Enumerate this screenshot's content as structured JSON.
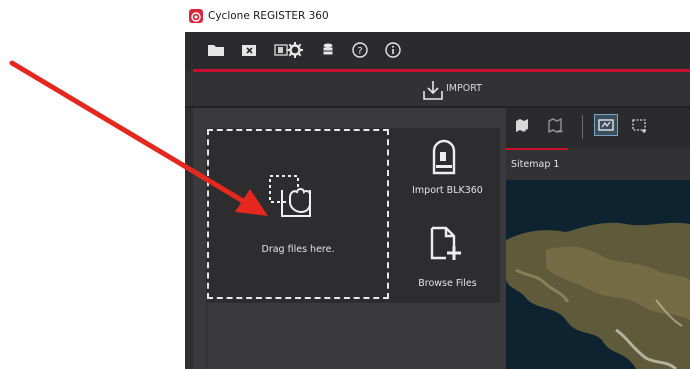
{
  "window": {
    "title": "Cyclone REGISTER 360",
    "app_icon": "cyclone-logo-icon",
    "accent": "#c8102e"
  },
  "toolbar": {
    "icons": [
      "open-folder-icon",
      "close-project-icon",
      "tablet-icon",
      "settings-gear-icon",
      "database-icon",
      "help-icon",
      "info-icon"
    ]
  },
  "import_bar": {
    "label": "IMPORT",
    "icon": "import-arrow-icon"
  },
  "import_panel": {
    "drop_zone_label": "Drag files here.",
    "drop_zone_icon": "drag-hand-icon",
    "import_blk_label": "Import BLK360",
    "import_blk_icon": "blk360-scanner-icon",
    "browse_label": "Browse Files",
    "browse_icon": "add-file-icon"
  },
  "sitemap": {
    "tab_label": "Sitemap 1",
    "toolbar_icons": [
      "map-add-icon",
      "map-remove-icon",
      "map-view-icon",
      "select-rectangle-icon"
    ]
  },
  "annotation": {
    "arrow_color": "#e5281e"
  }
}
